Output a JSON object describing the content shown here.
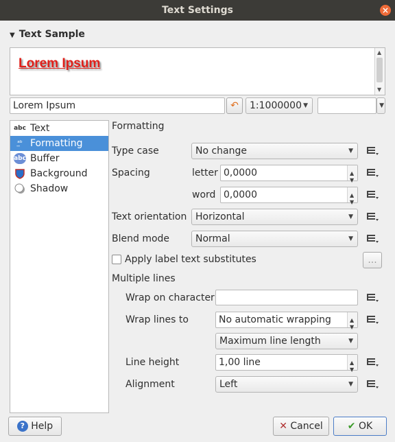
{
  "window": {
    "title": "Text Settings",
    "close": "×"
  },
  "text_sample": {
    "header": "Text Sample",
    "preview_text": "Lorem Ipsum",
    "sample_input": "Lorem Ipsum",
    "scale": "1:1000000",
    "colors": {
      "sample": "#e0201a",
      "selection": "#4a90d9"
    }
  },
  "sidebar": {
    "items": [
      {
        "label": "Text",
        "icon": "abc"
      },
      {
        "label": "Formatting",
        "icon": "abc"
      },
      {
        "label": "Buffer",
        "icon": "abc"
      },
      {
        "label": "Background",
        "icon": "shield-icon"
      },
      {
        "label": "Shadow",
        "icon": "shadow-icon"
      }
    ],
    "selected": "Formatting"
  },
  "formatting": {
    "title": "Formatting",
    "type_case_label": "Type case",
    "type_case_value": "No change",
    "spacing_label": "Spacing",
    "letter_label": "letter",
    "letter_value": "0,0000",
    "word_label": "word",
    "word_value": "0,0000",
    "orientation_label": "Text orientation",
    "orientation_value": "Horizontal",
    "blend_label": "Blend mode",
    "blend_value": "Normal",
    "substitutes_label": "Apply label text substitutes",
    "substitutes_button": "...",
    "multiple_lines_label": "Multiple lines",
    "wrap_char_label": "Wrap on character",
    "wrap_char_value": "",
    "wrap_lines_label": "Wrap lines to",
    "wrap_lines_value": "No automatic wrapping",
    "wrap_mode_value": "Maximum line length",
    "line_height_label": "Line height",
    "line_height_value": "1,00 line",
    "alignment_label": "Alignment",
    "alignment_value": "Left"
  },
  "footer": {
    "help": "Help",
    "cancel": "Cancel",
    "ok": "OK"
  }
}
